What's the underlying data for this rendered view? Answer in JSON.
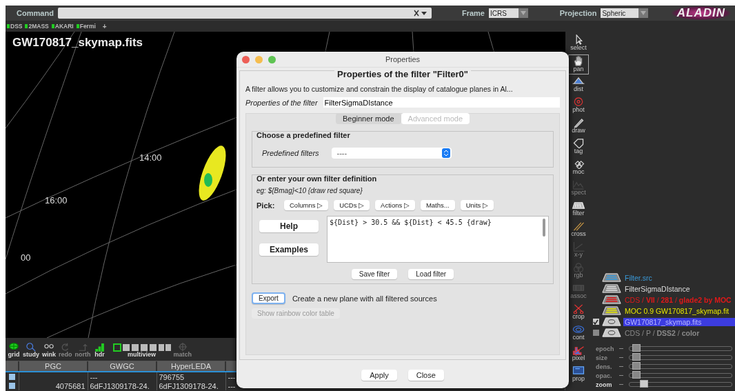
{
  "command_bar": {
    "label": "Command",
    "frame_label": "Frame",
    "frame_value": "ICRS",
    "projection_label": "Projection",
    "projection_value": "Spheric",
    "logo": "ALADIN"
  },
  "surveys": [
    {
      "label": "DSS"
    },
    {
      "label": "2MASS"
    },
    {
      "label": "AKARI"
    },
    {
      "label": "Fermi"
    }
  ],
  "add_survey": "+",
  "view": {
    "title": "GW170817_skymap.fits",
    "grid_labels": [
      "14:00",
      "16:00",
      "00"
    ]
  },
  "view_tools": [
    {
      "label": "grid",
      "disabled": false
    },
    {
      "label": "study",
      "disabled": false
    },
    {
      "label": "wink",
      "disabled": false
    },
    {
      "label": "redo",
      "disabled": true
    },
    {
      "label": "north",
      "disabled": true
    },
    {
      "label": "hdr",
      "disabled": false
    },
    {
      "label": "multiview",
      "disabled": false
    },
    {
      "label": "match",
      "disabled": true
    }
  ],
  "table": {
    "columns": [
      "PGC",
      "GWGC",
      "HyperLEDA"
    ],
    "rows": [
      [
        null,
        "---",
        "796755",
        "---"
      ],
      [
        "4075681",
        "6dFJ1309178-24.",
        "6dFJ1309178-24.",
        "---"
      ]
    ]
  },
  "tools": [
    {
      "label": "select",
      "disabled": false,
      "selected": false
    },
    {
      "label": "pan",
      "disabled": false,
      "selected": true
    },
    {
      "label": "dist",
      "disabled": false,
      "selected": false
    },
    {
      "label": "phot",
      "disabled": false,
      "selected": false
    },
    {
      "label": "draw",
      "disabled": false,
      "selected": false
    },
    {
      "label": "tag",
      "disabled": false,
      "selected": false
    },
    {
      "label": "moc",
      "disabled": false,
      "selected": false
    },
    {
      "label": "spect",
      "disabled": true,
      "selected": false
    },
    {
      "label": "filter",
      "disabled": false,
      "selected": false
    },
    {
      "label": "cross",
      "disabled": false,
      "selected": false
    },
    {
      "label": "x-y",
      "disabled": true,
      "selected": false
    },
    {
      "label": "rgb",
      "disabled": true,
      "selected": false
    },
    {
      "label": "assoc",
      "disabled": true,
      "selected": false
    },
    {
      "label": "crop",
      "disabled": false,
      "selected": false
    },
    {
      "label": "cont",
      "disabled": false,
      "selected": false
    },
    {
      "label": "pixel",
      "disabled": false,
      "selected": false
    },
    {
      "label": "prop",
      "disabled": false,
      "selected": false
    }
  ],
  "layers": [
    {
      "kind": "catalog",
      "name": "Filter.src",
      "color": "#3a9ad9",
      "selected": false
    },
    {
      "kind": "catalog",
      "name": "FilterSigmaDIstance",
      "color": "#dddddd",
      "selected": false
    },
    {
      "kind": "catalog",
      "name": "CDS / **VII** / **281** / **glade2 by MOC**",
      "color": "#e01818",
      "selected": false
    },
    {
      "kind": "catalog",
      "name": "MOC 0.9 GW170817_skymap.fit",
      "color": "#e6e600",
      "selected": false
    },
    {
      "kind": "image",
      "name": "GW170817_skymap.fits",
      "selected": true,
      "checked": true
    },
    {
      "kind": "image",
      "name": "CDS / P / **DSS2** / **color**",
      "color": "#8a8a8a",
      "selected": false,
      "checked": false
    }
  ],
  "sliders": [
    {
      "label": "epoch",
      "disabled": true,
      "level": 0.03
    },
    {
      "label": "size",
      "disabled": true,
      "level": 0.03
    },
    {
      "label": "dens.",
      "disabled": true,
      "level": 0.03
    },
    {
      "label": "opac.",
      "disabled": true,
      "level": 0.03
    },
    {
      "label": "zoom",
      "disabled": false,
      "level": 0.1
    }
  ],
  "dialog": {
    "title": "Properties",
    "heading": "Properties of the filter \"Filter0\"",
    "description": "A filter allows you to customize and constrain the display of catalogue planes in Al...",
    "name_label": "Properties of the filter",
    "name_value": "FilterSigmaDIstance",
    "tabs": [
      {
        "label": "Beginner mode",
        "selected": true
      },
      {
        "label": "Advanced mode",
        "selected": false
      }
    ],
    "predefined_group": "Choose a predefined filter",
    "predefined_label": "Predefined filters",
    "predefined_value": "----",
    "custom_group": "Or enter your own filter definition",
    "example": "eg: ${Bmag}<10 {draw red square}",
    "pick_label": "Pick:",
    "pick_buttons": [
      "Columns ▷",
      "UCDs ▷",
      "Actions ▷",
      "Maths...",
      "Units ▷"
    ],
    "side_buttons": [
      "Help",
      "Examples"
    ],
    "expression": "${Dist} > 30.5 && ${Dist} < 45.5 {draw}",
    "file_buttons": [
      "Save filter",
      "Load filter"
    ],
    "export_button": "Export",
    "export_text": "Create a new plane with all filtered sources",
    "rainbow_button": "Show rainbow color table",
    "rainbow_disabled": true,
    "footer_buttons": [
      "Apply",
      "Close"
    ]
  }
}
